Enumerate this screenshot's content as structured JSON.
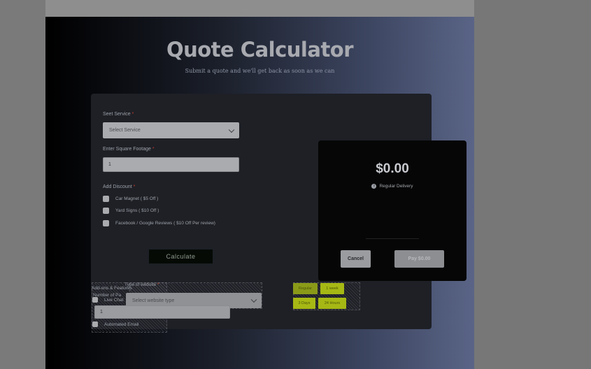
{
  "page": {
    "title": "Quote Calculator",
    "subtitle": "Submit a quote and we'll get back as soon as we can"
  },
  "form": {
    "service": {
      "label": "Seet Service",
      "required_mark": "*",
      "placeholder": "Select Service"
    },
    "footage": {
      "label": "Enter Square Footage",
      "required_mark": "*",
      "value": "1"
    },
    "discount": {
      "label": "Add Discount",
      "required_mark": "*",
      "options": [
        "Car Magnet ( $5 Off )",
        "Yard Signs ( $10 Off )",
        "Facebook / Google Reviews ( $10 Off Per review)"
      ]
    },
    "calculate_label": "Calculate"
  },
  "summary": {
    "amount": "$0.00",
    "delivery_label": "Regular Delivery",
    "cancel_label": "Cancel",
    "pay_label": "Pay $0.00"
  },
  "overlay": {
    "type_of_website_label": "Type of website",
    "required_mark": "*",
    "addons_label": "Add-ons & Features",
    "pages_label": "Number of Pa",
    "live_chat_label": "Live Chat",
    "website_type_placeholder": "Select website type",
    "pages_value": "1",
    "automated_email_label": "Automated Email",
    "delivery_chips": [
      "Regular",
      "1 week",
      "3 Days",
      "24 Hours"
    ]
  },
  "colors": {
    "accent_chip": "#a6b814",
    "required": "#c0392b"
  }
}
